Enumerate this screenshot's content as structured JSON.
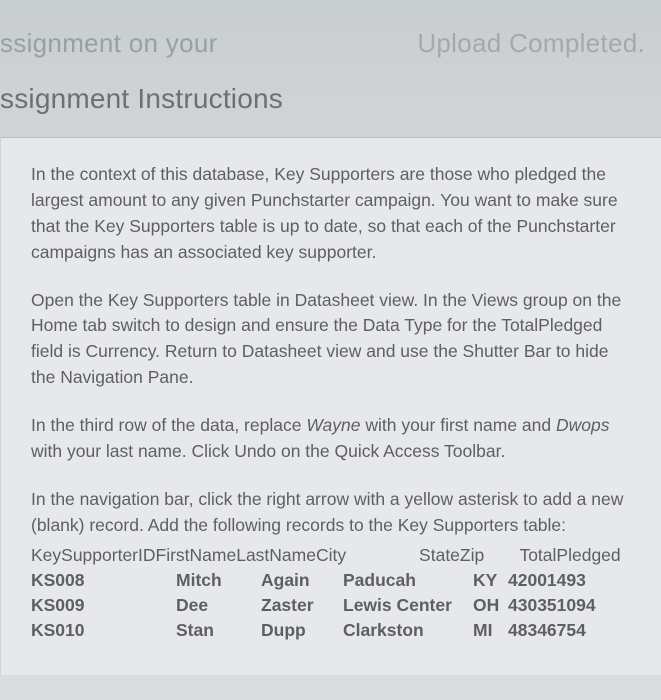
{
  "top": {
    "left": "ssignment on your",
    "right": "Upload Completed."
  },
  "section_title": "ssignment Instructions",
  "paras": {
    "p1": "In the context of this database, Key Supporters are those who pledged the largest amount to any given Punchstarter campaign. You want to make sure that the Key Supporters table is up to date, so that each of the Punchstarter campaigns has an associated key supporter.",
    "p2": "Open the Key Supporters table in Datasheet view. In the Views group on the Home tab switch to design and ensure the Data Type for the TotalPledged field is Currency. Return to Datasheet view and use the Shutter Bar to hide the Navigation Pane.",
    "p3a": "In the third row of the data, replace ",
    "p3b": "Wayne",
    "p3c": " with your first name and ",
    "p3d": "Dwops",
    "p3e": " with your last name. Click Undo on the Quick Access Toolbar.",
    "p4": "In the navigation bar, click the right arrow with a yellow asterisk to add a new (blank) record. Add the following records to the Key Supporters table:"
  },
  "table": {
    "headers": {
      "idfnln": "KeySupporterIDFirstNameLastNameCity",
      "statezip": "StateZip",
      "total": "TotalPledged"
    },
    "rows": [
      {
        "id": "KS008",
        "fn": "Mitch",
        "ln": "Again",
        "city": "Paducah",
        "st": "KY",
        "zip": "42001493"
      },
      {
        "id": "KS009",
        "fn": "Dee",
        "ln": "Zaster",
        "city": "Lewis Center",
        "st": "OH",
        "zip": "430351094"
      },
      {
        "id": "KS010",
        "fn": "Stan",
        "ln": "Dupp",
        "city": "Clarkston",
        "st": "MI",
        "zip": "48346754"
      }
    ]
  }
}
